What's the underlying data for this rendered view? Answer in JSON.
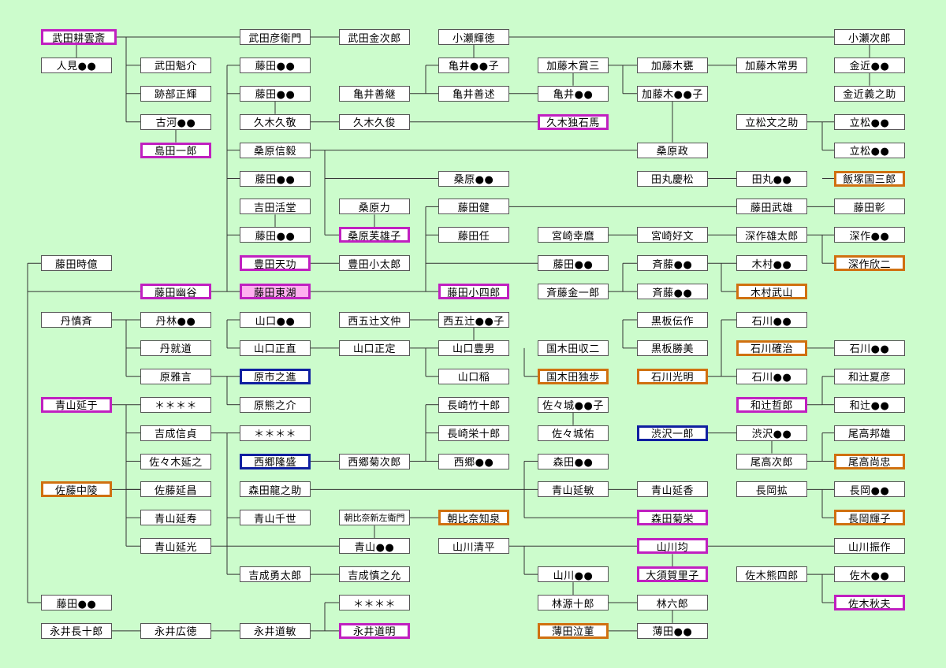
{
  "nodes": [
    {
      "id": "n1",
      "text": "武田耕雲斎",
      "style": "purple"
    },
    {
      "id": "n2",
      "text": "人見●●"
    },
    {
      "id": "n3",
      "text": "武田魁介"
    },
    {
      "id": "n4",
      "text": "跡部正輝"
    },
    {
      "id": "n5",
      "text": "古河●●"
    },
    {
      "id": "n6",
      "text": "島田一郎",
      "style": "purple"
    },
    {
      "id": "n7",
      "text": "武田彦衛門"
    },
    {
      "id": "n8",
      "text": "武田金次郎"
    },
    {
      "id": "n9",
      "text": "藤田●●"
    },
    {
      "id": "n10",
      "text": "藤田●●"
    },
    {
      "id": "n11",
      "text": "久木久敬"
    },
    {
      "id": "n12",
      "text": "久木久俊"
    },
    {
      "id": "n13",
      "text": "桑原信毅"
    },
    {
      "id": "n14",
      "text": "藤田●●"
    },
    {
      "id": "n15",
      "text": "吉田活堂"
    },
    {
      "id": "n16",
      "text": "藤田●●"
    },
    {
      "id": "n17",
      "text": "豊田天功",
      "style": "purple"
    },
    {
      "id": "n18",
      "text": "藤田時億"
    },
    {
      "id": "n19",
      "text": "藤田幽谷",
      "style": "purple"
    },
    {
      "id": "n20",
      "text": "藤田東湖",
      "style": "purple",
      "fill": "pink"
    },
    {
      "id": "n21",
      "text": "丹慎斉"
    },
    {
      "id": "n22",
      "text": "丹林●●"
    },
    {
      "id": "n23",
      "text": "丹就道"
    },
    {
      "id": "n24",
      "text": "原雅言"
    },
    {
      "id": "n25",
      "text": "青山延于",
      "style": "purple"
    },
    {
      "id": "n26",
      "text": "＊＊＊＊"
    },
    {
      "id": "n27",
      "text": "吉成信貞"
    },
    {
      "id": "n28",
      "text": "佐々木延之"
    },
    {
      "id": "n29",
      "text": "佐藤中陵",
      "style": "orange"
    },
    {
      "id": "n30",
      "text": "佐藤延昌"
    },
    {
      "id": "n31",
      "text": "青山延寿"
    },
    {
      "id": "n32",
      "text": "青山延光"
    },
    {
      "id": "n33",
      "text": "藤田●●"
    },
    {
      "id": "n34",
      "text": "永井長十郎"
    },
    {
      "id": "n35",
      "text": "永井広徳"
    },
    {
      "id": "n36",
      "text": "山口●●"
    },
    {
      "id": "n37",
      "text": "山口正直"
    },
    {
      "id": "n38",
      "text": "原市之進",
      "style": "blue"
    },
    {
      "id": "n39",
      "text": "原熊之介"
    },
    {
      "id": "n40",
      "text": "＊＊＊＊"
    },
    {
      "id": "n41",
      "text": "西郷隆盛",
      "style": "blue"
    },
    {
      "id": "n42",
      "text": "森田龍之助"
    },
    {
      "id": "n43",
      "text": "青山千世"
    },
    {
      "id": "n44",
      "text": "吉成勇太郎"
    },
    {
      "id": "n45",
      "text": "永井道敏"
    },
    {
      "id": "n46",
      "text": "桑原力"
    },
    {
      "id": "n47",
      "text": "桑原芙雄子",
      "style": "purple"
    },
    {
      "id": "n48",
      "text": "豊田小太郎"
    },
    {
      "id": "n49",
      "text": "西五辻文仲"
    },
    {
      "id": "n50",
      "text": "山口正定"
    },
    {
      "id": "n51",
      "text": "西郷菊次郎"
    },
    {
      "id": "n52",
      "text": "朝比奈新左衛門",
      "size": "small"
    },
    {
      "id": "n53",
      "text": "青山●●"
    },
    {
      "id": "n54",
      "text": "吉成慎之允"
    },
    {
      "id": "n55",
      "text": "＊＊＊＊"
    },
    {
      "id": "n56",
      "text": "永井道明",
      "style": "purple"
    },
    {
      "id": "n57",
      "text": "小瀬輝徳"
    },
    {
      "id": "n58",
      "text": "亀井●●子"
    },
    {
      "id": "n59",
      "text": "亀井善継"
    },
    {
      "id": "n60",
      "text": "亀井善述"
    },
    {
      "id": "n61",
      "text": "桑原●●"
    },
    {
      "id": "n62",
      "text": "藤田健"
    },
    {
      "id": "n63",
      "text": "藤田任"
    },
    {
      "id": "n64",
      "text": "藤田小四郎",
      "style": "purple"
    },
    {
      "id": "n65",
      "text": "西五辻●●子"
    },
    {
      "id": "n66",
      "text": "山口豊男"
    },
    {
      "id": "n67",
      "text": "山口稲"
    },
    {
      "id": "n68",
      "text": "長崎竹十郎"
    },
    {
      "id": "n69",
      "text": "長崎栄十郎"
    },
    {
      "id": "n70",
      "text": "西郷●●"
    },
    {
      "id": "n71",
      "text": "朝比奈知泉",
      "style": "orange"
    },
    {
      "id": "n72",
      "text": "山川清平"
    },
    {
      "id": "n73",
      "text": "加藤木賞三"
    },
    {
      "id": "n74",
      "text": "亀井●●"
    },
    {
      "id": "n75",
      "text": "久木独石馬",
      "style": "purple"
    },
    {
      "id": "n76",
      "text": "宮崎幸麿"
    },
    {
      "id": "n77",
      "text": "藤田●●"
    },
    {
      "id": "n78",
      "text": "斉藤金一郎"
    },
    {
      "id": "n79",
      "text": "国木田収二"
    },
    {
      "id": "n80",
      "text": "国木田独歩",
      "style": "orange"
    },
    {
      "id": "n81",
      "text": "佐々城●●子"
    },
    {
      "id": "n82",
      "text": "佐々城佑"
    },
    {
      "id": "n83",
      "text": "森田●●"
    },
    {
      "id": "n84",
      "text": "青山延敏"
    },
    {
      "id": "n85",
      "text": "山川●●"
    },
    {
      "id": "n86",
      "text": "林源十郎"
    },
    {
      "id": "n87",
      "text": "薄田泣菫",
      "style": "orange"
    },
    {
      "id": "n88",
      "text": "加藤木甕"
    },
    {
      "id": "n89",
      "text": "加藤木●●子"
    },
    {
      "id": "n90",
      "text": "桑原政"
    },
    {
      "id": "n91",
      "text": "田丸慶松"
    },
    {
      "id": "n92",
      "text": "宮崎好文"
    },
    {
      "id": "n93",
      "text": "斉藤●●"
    },
    {
      "id": "n94",
      "text": "斉藤●●"
    },
    {
      "id": "n95",
      "text": "黒板伝作"
    },
    {
      "id": "n96",
      "text": "黒板勝美"
    },
    {
      "id": "n97",
      "text": "石川光明",
      "style": "orange"
    },
    {
      "id": "n98",
      "text": "渋沢一郎",
      "style": "blue"
    },
    {
      "id": "n99",
      "text": "青山延香"
    },
    {
      "id": "n100",
      "text": "森田菊栄",
      "style": "purple"
    },
    {
      "id": "n101",
      "text": "山川均",
      "style": "purple"
    },
    {
      "id": "n102",
      "text": "大須賀里子",
      "style": "purple"
    },
    {
      "id": "n103",
      "text": "林六郎"
    },
    {
      "id": "n104",
      "text": "薄田●●"
    },
    {
      "id": "n105",
      "text": "加藤木常男"
    },
    {
      "id": "n106",
      "text": "立松文之助"
    },
    {
      "id": "n107",
      "text": "田丸●●"
    },
    {
      "id": "n108",
      "text": "藤田武雄"
    },
    {
      "id": "n109",
      "text": "深作雄太郎"
    },
    {
      "id": "n110",
      "text": "木村●●"
    },
    {
      "id": "n111",
      "text": "木村武山",
      "style": "orange"
    },
    {
      "id": "n112",
      "text": "石川●●"
    },
    {
      "id": "n113",
      "text": "石川確治",
      "style": "orange"
    },
    {
      "id": "n114",
      "text": "石川●●"
    },
    {
      "id": "n115",
      "text": "和辻哲郎",
      "style": "purple"
    },
    {
      "id": "n116",
      "text": "渋沢●●"
    },
    {
      "id": "n117",
      "text": "尾高次郎"
    },
    {
      "id": "n118",
      "text": "長岡拡"
    },
    {
      "id": "n119",
      "text": "佐木熊四郎"
    },
    {
      "id": "n120",
      "text": "小瀬次郎"
    },
    {
      "id": "n121",
      "text": "金近●●"
    },
    {
      "id": "n122",
      "text": "金近義之助"
    },
    {
      "id": "n123",
      "text": "立松●●"
    },
    {
      "id": "n124",
      "text": "立松●●"
    },
    {
      "id": "n125",
      "text": "飯塚国三郎",
      "style": "orange"
    },
    {
      "id": "n126",
      "text": "藤田彰"
    },
    {
      "id": "n127",
      "text": "深作●●"
    },
    {
      "id": "n128",
      "text": "深作欣二",
      "style": "orange"
    },
    {
      "id": "n129",
      "text": "石川●●"
    },
    {
      "id": "n130",
      "text": "和辻夏彦"
    },
    {
      "id": "n131",
      "text": "和辻●●"
    },
    {
      "id": "n132",
      "text": "尾高邦雄"
    },
    {
      "id": "n133",
      "text": "尾高尚忠",
      "style": "orange"
    },
    {
      "id": "n134",
      "text": "長岡●●"
    },
    {
      "id": "n135",
      "text": "長岡輝子",
      "style": "orange"
    },
    {
      "id": "n136",
      "text": "山川振作"
    },
    {
      "id": "n137",
      "text": "佐木●●"
    },
    {
      "id": "n138",
      "text": "佐木秋夫",
      "style": "purple"
    }
  ],
  "colors": {
    "background": "#ccfccc",
    "box_fill": "#ffffff",
    "highlight_fill": "#ffb0f0",
    "purple": "#c020c0",
    "orange": "#d07010",
    "blue": "#1020a0",
    "line": "#333333"
  }
}
